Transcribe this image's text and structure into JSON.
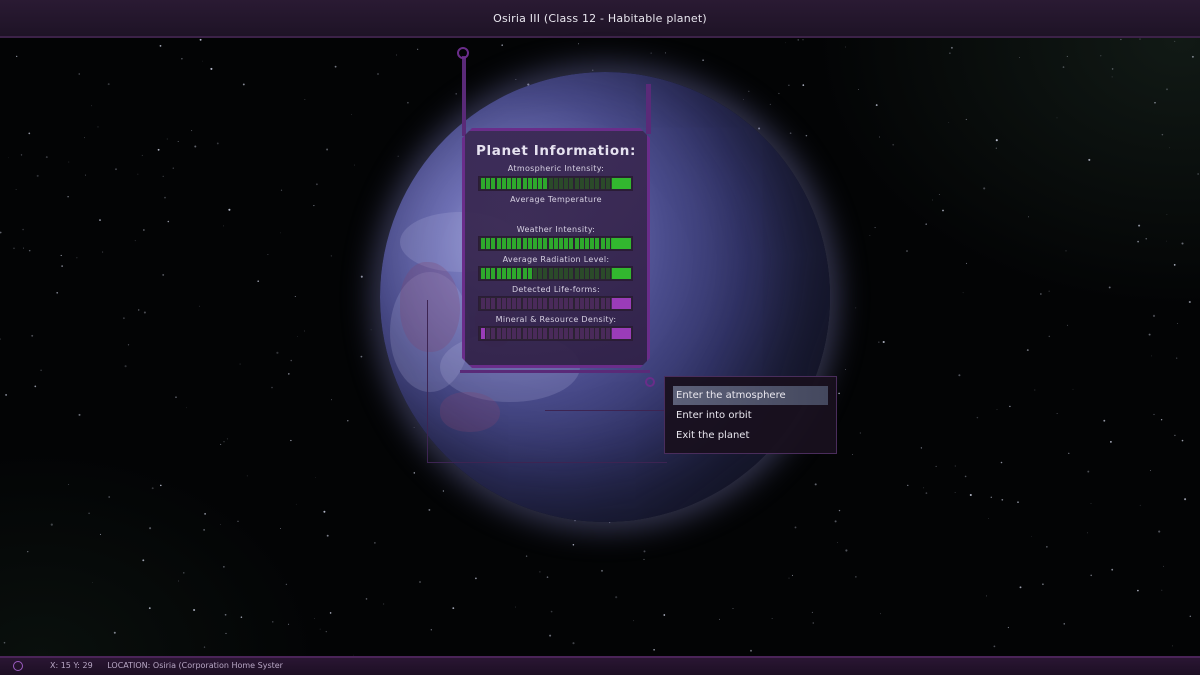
{
  "header": {
    "title": "Osiria III (Class 12 - Habitable planet)"
  },
  "status_bar": {
    "coords": "X: 15 Y: 29",
    "location": "LOCATION: Osiria (Corporation Home Syster"
  },
  "info_panel": {
    "title": "Planet Information:",
    "stats": [
      {
        "label": "Atmospheric Intensity:",
        "level": 0.5,
        "color": "#2ea82c",
        "dim": "#2b4a2a",
        "cap": "#32b82f"
      },
      {
        "label": "Average Temperature",
        "level": null,
        "color": null,
        "dim": null,
        "cap": null
      },
      {
        "label": "Weather Intensity:",
        "level": 1.0,
        "color": "#2ea82c",
        "dim": "#2b4a2a",
        "cap": "#32b82f"
      },
      {
        "label": "Average Radiation Level:",
        "level": 0.4,
        "color": "#2ea82c",
        "dim": "#2b4a2a",
        "cap": "#32b82f"
      },
      {
        "label": "Detected Life-forms:",
        "level": 0.0,
        "color": "#9a3cb8",
        "dim": "#4a2a5a",
        "cap": "#9a3cb8"
      },
      {
        "label": "Mineral & Resource Density:",
        "level": 0.05,
        "color": "#9a3cb8",
        "dim": "#4a2a5a",
        "cap": "#9a3cb8"
      }
    ]
  },
  "context_menu": {
    "items": [
      {
        "label": "Enter the atmosphere",
        "selected": true
      },
      {
        "label": "Enter into orbit",
        "selected": false
      },
      {
        "label": "Exit the planet",
        "selected": false
      }
    ]
  },
  "colors": {
    "accent_purple": "#6a2d8a",
    "bar_green": "#2ea82c",
    "bar_purple": "#9a3cb8"
  }
}
